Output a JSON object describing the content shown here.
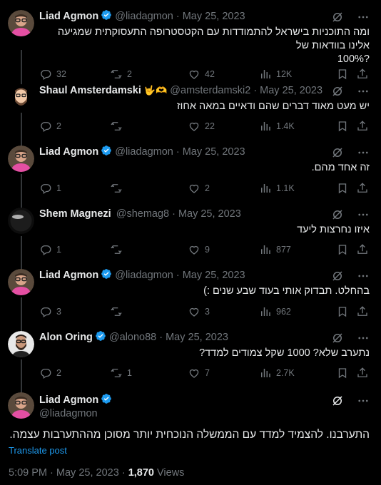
{
  "colors": {
    "background": "#000000",
    "text": "#e7e9ea",
    "muted": "#71767b",
    "accent": "#1d9bf0",
    "verified": "#1d9bf0"
  },
  "replies": [
    {
      "name": "Liad Agmon",
      "verified": true,
      "emoji": "",
      "handle": "@liadagmon",
      "date": "May 25, 2023",
      "text_lines": [
        "ומה התוכניות בישראל להתמודדות עם הקטסטרופה התעסוקתית שמגיעה אלינו בוודאות של",
        "?100%"
      ],
      "replies": "32",
      "retweets": "2",
      "likes": "42",
      "views": "12K",
      "avatar": "person-glasses-pink"
    },
    {
      "name": "Shaul Amsterdamski",
      "verified": false,
      "emoji": "🤟🫶",
      "handle": "@amsterdamski2",
      "date": "May 25, 2023",
      "text_lines": [
        "יש מעט מאוד דברים שהם ודאיים במאה אחוז"
      ],
      "replies": "2",
      "retweets": "",
      "likes": "22",
      "views": "1.4K",
      "avatar": "cartoon-beard"
    },
    {
      "name": "Liad Agmon",
      "verified": true,
      "emoji": "",
      "handle": "@liadagmon",
      "date": "May 25, 2023",
      "text_lines": [
        "זה אחד מהם."
      ],
      "replies": "1",
      "retweets": "",
      "likes": "2",
      "views": "1.1K",
      "avatar": "person-glasses-pink"
    },
    {
      "name": "Shem Magnezi",
      "verified": false,
      "emoji": "",
      "handle": "@shemag8",
      "date": "May 25, 2023",
      "text_lines": [
        "איזו נחרצות ליעד"
      ],
      "replies": "1",
      "retweets": "",
      "likes": "9",
      "views": "877",
      "avatar": "dark-circle"
    },
    {
      "name": "Liad Agmon",
      "verified": true,
      "emoji": "",
      "handle": "@liadagmon",
      "date": "May 25, 2023",
      "text_lines": [
        "בהחלט. תבדוק אותי בעוד שבע שנים :)"
      ],
      "replies": "3",
      "retweets": "",
      "likes": "3",
      "views": "962",
      "avatar": "person-glasses-pink"
    },
    {
      "name": "Alon Oring",
      "verified": true,
      "emoji": "",
      "handle": "@alono88",
      "date": "May 25, 2023",
      "text_lines": [
        "נתערב שלא? 1000 שקל צמודים למדד?"
      ],
      "replies": "2",
      "retweets": "1",
      "likes": "7",
      "views": "2.7K",
      "avatar": "person-beard-white"
    }
  ],
  "main": {
    "name": "Liad Agmon",
    "handle": "@liadagmon",
    "text": "התערבנו. להצמיד למדד עם הממשלה הנוכחית יותר מסוכן מההתערבות עצמה.",
    "translate": "Translate post",
    "time": "5:09 PM",
    "date": "May 25, 2023",
    "views_count": "1,870",
    "views_label": "Views",
    "separator": "·"
  },
  "icons": [
    "grok-icon",
    "more-icon",
    "reply-icon",
    "retweet-icon",
    "like-icon",
    "views-icon",
    "bookmark-icon",
    "share-icon",
    "verified-icon"
  ]
}
